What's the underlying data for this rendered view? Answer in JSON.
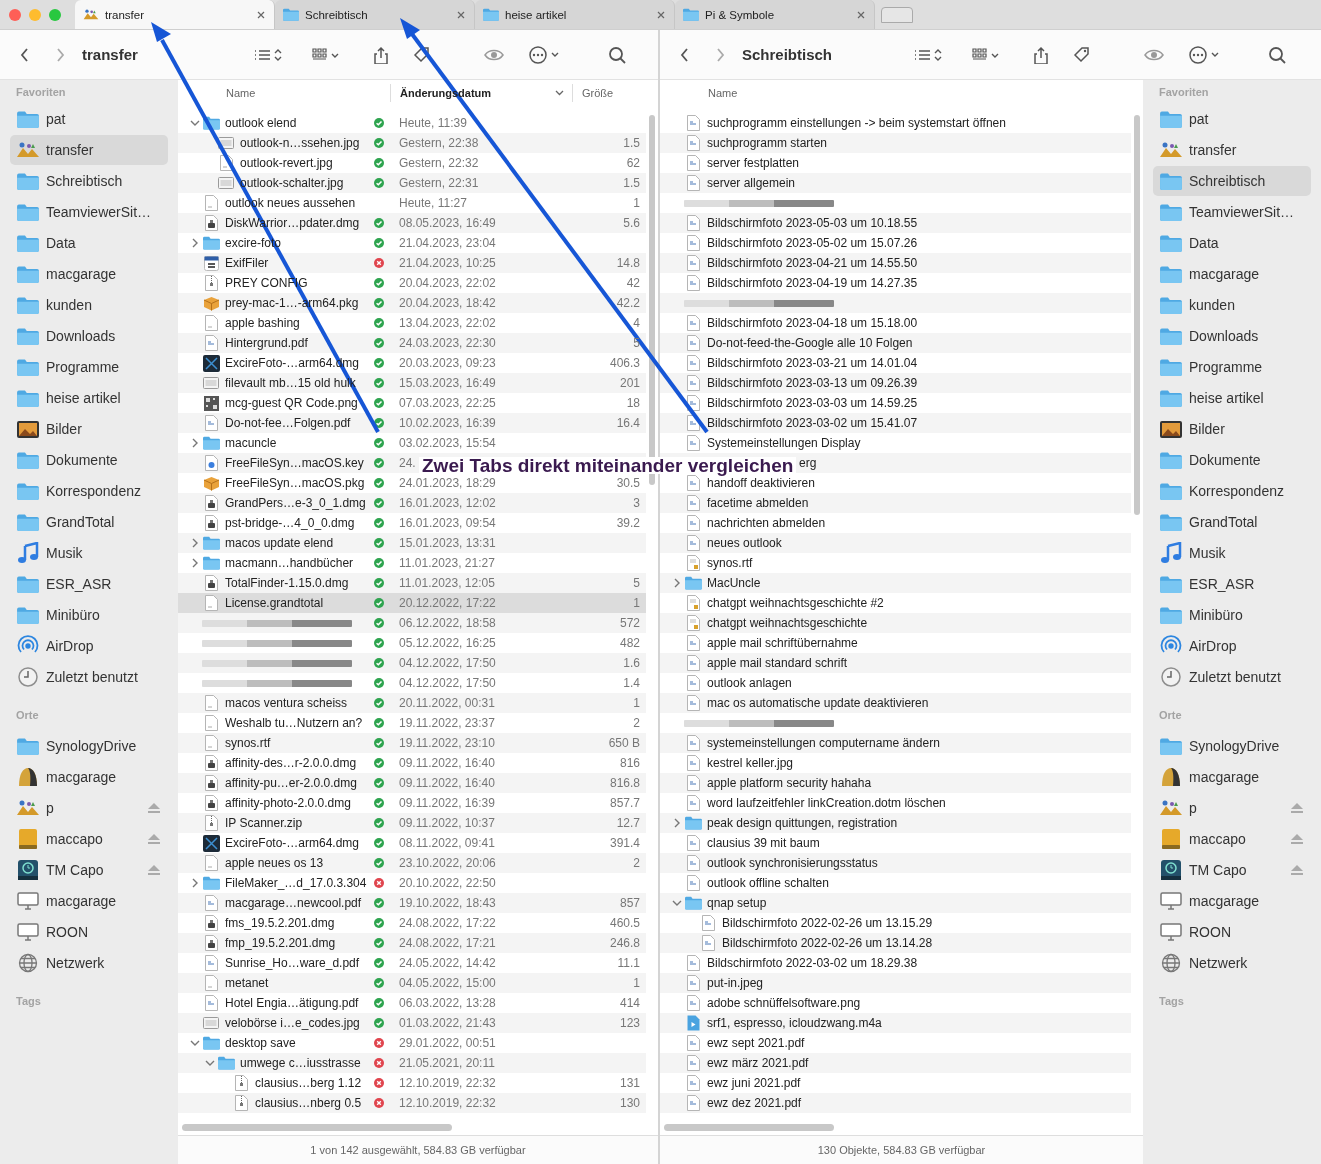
{
  "tabs": [
    {
      "label": "transfer",
      "kind": "image",
      "selected": true
    },
    {
      "label": "Schreibtisch",
      "kind": "folder",
      "selected": false
    },
    {
      "label": "heise artikel",
      "kind": "folder",
      "selected": false
    },
    {
      "label": "Pi & Symbole",
      "kind": "folder",
      "selected": false
    }
  ],
  "panes": [
    {
      "title": "transfer",
      "sidebar": [
        {
          "heading": "Favoriten",
          "items": [
            {
              "label": "pat",
              "kind": "folder",
              "selected": false
            },
            {
              "label": "transfer",
              "kind": "image",
              "selected": true
            },
            {
              "label": "Schreibtisch",
              "kind": "folder",
              "selected": false
            },
            {
              "label": "TeamviewerSit…",
              "kind": "folder",
              "selected": false
            },
            {
              "label": "Data",
              "kind": "folder",
              "selected": false
            },
            {
              "label": "macgarage",
              "kind": "folder",
              "selected": false
            },
            {
              "label": "kunden",
              "kind": "folder",
              "selected": false
            },
            {
              "label": "Downloads",
              "kind": "folder",
              "selected": false
            },
            {
              "label": "Programme",
              "kind": "folder",
              "selected": false
            },
            {
              "label": "heise artikel",
              "kind": "folder",
              "selected": false
            },
            {
              "label": "Bilder",
              "kind": "photo",
              "selected": false
            },
            {
              "label": "Dokumente",
              "kind": "folder",
              "selected": false
            },
            {
              "label": "Korrespondenz",
              "kind": "folder",
              "selected": false
            },
            {
              "label": "GrandTotal",
              "kind": "folder",
              "selected": false
            },
            {
              "label": "Musik",
              "kind": "music",
              "selected": false
            },
            {
              "label": "ESR_ASR",
              "kind": "folder",
              "selected": false
            },
            {
              "label": "Minibüro",
              "kind": "folder",
              "selected": false
            },
            {
              "label": "AirDrop",
              "kind": "airdrop",
              "selected": false
            },
            {
              "label": "Zuletzt benutzt",
              "kind": "clock",
              "selected": false
            }
          ]
        },
        {
          "heading": "Orte",
          "items": [
            {
              "label": "SynologyDrive",
              "kind": "folder",
              "selected": false,
              "eject": false
            },
            {
              "label": "macgarage",
              "kind": "dome",
              "selected": false,
              "eject": false
            },
            {
              "label": "p",
              "kind": "image",
              "selected": false,
              "eject": true
            },
            {
              "label": "maccapo",
              "kind": "drive",
              "selected": false,
              "eject": true
            },
            {
              "label": "TM Capo",
              "kind": "timemachine",
              "selected": false,
              "eject": true
            },
            {
              "label": "macgarage",
              "kind": "computer",
              "selected": false,
              "eject": false
            },
            {
              "label": "ROON",
              "kind": "computer",
              "selected": false,
              "eject": false
            },
            {
              "label": "Netzwerk",
              "kind": "network",
              "selected": false,
              "eject": false
            }
          ]
        },
        {
          "heading": "Tags"
        }
      ],
      "columns": [
        {
          "label": "Name",
          "sorted": false
        },
        {
          "label": "Änderungsdatum",
          "sorted": true
        },
        {
          "label": "Größe",
          "sorted": false
        }
      ],
      "rows": [
        {
          "name": "outlook elend",
          "kind": "folder",
          "expanded": true,
          "synced": true,
          "date": "Heute, 11:39",
          "selected": false,
          "children": [
            {
              "name": "outlook-n…ssehen.jpg",
              "kind": "image",
              "synced": true,
              "date": "Gestern, 22:38",
              "size": "1.5",
              "selected": false
            },
            {
              "name": "outlook-revert.jpg",
              "kind": "doc",
              "synced": true,
              "date": "Gestern, 22:32",
              "size": "62",
              "selected": false
            },
            {
              "name": "outlook-schalter.jpg",
              "kind": "image",
              "synced": true,
              "date": "Gestern, 22:31",
              "size": "1.5",
              "selected": false
            }
          ]
        },
        {
          "name": "outlook neues aussehen",
          "kind": "doc",
          "date": "Heute, 11:27",
          "size": "1",
          "selected": false
        },
        {
          "name": "DiskWarrior…pdater.dmg",
          "kind": "dmg",
          "synced": true,
          "date": "08.05.2023, 16:49",
          "size": "5.6",
          "selected": false
        },
        {
          "name": "excire-foto",
          "kind": "folder",
          "expanded": false,
          "synced": true,
          "date": "21.04.2023, 23:04",
          "selected": false
        },
        {
          "name": "ExifFiler",
          "kind": "calendar",
          "synced": false,
          "date": "21.04.2023, 10:25",
          "size": "14.8",
          "selected": false
        },
        {
          "name": "PREY CONFIG",
          "kind": "zip",
          "synced": true,
          "date": "20.04.2023, 22:02",
          "size": "42",
          "selected": false
        },
        {
          "name": "prey-mac-1…-arm64.pkg",
          "kind": "pkg",
          "synced": true,
          "date": "20.04.2023, 18:42",
          "size": "42.2",
          "selected": false
        },
        {
          "name": "apple bashing",
          "kind": "doc",
          "synced": true,
          "date": "13.04.2023, 22:02",
          "size": "4",
          "selected": false
        },
        {
          "name": "Hintergrund.pdf",
          "kind": "pdf",
          "synced": true,
          "date": "24.03.2023, 22:30",
          "size": "5",
          "selected": false
        },
        {
          "name": "ExcireFoto-…arm64.dmg",
          "kind": "app",
          "synced": true,
          "date": "20.03.2023, 09:23",
          "size": "406.3",
          "selected": false
        },
        {
          "name": "filevault mb…15 old hulk",
          "kind": "image",
          "synced": true,
          "date": "15.03.2023, 16:49",
          "size": "201",
          "selected": false
        },
        {
          "name": "mcg-guest QR Code.png",
          "kind": "qr",
          "synced": true,
          "date": "07.03.2023, 22:25",
          "size": "18",
          "selected": false
        },
        {
          "name": "Do-not-fee…Folgen.pdf",
          "kind": "pdf",
          "synced": true,
          "date": "10.02.2023, 16:39",
          "size": "16.4",
          "selected": false
        },
        {
          "name": "macuncle",
          "kind": "folder",
          "expanded": false,
          "synced": true,
          "date": "03.02.2023, 15:54",
          "selected": false
        },
        {
          "name": "FreeFileSyn…macOS.key",
          "kind": "key",
          "synced": true,
          "date": "24.",
          "selected": false
        },
        {
          "name": "FreeFileSyn…macOS.pkg",
          "kind": "pkg",
          "synced": true,
          "date": "24.01.2023, 18:29",
          "size": "30.5",
          "selected": false
        },
        {
          "name": "GrandPers…e-3_0_1.dmg",
          "kind": "dmg",
          "synced": true,
          "date": "16.01.2023, 12:02",
          "size": "3",
          "selected": false
        },
        {
          "name": "pst-bridge-…4_0_0.dmg",
          "kind": "dmg",
          "synced": true,
          "date": "16.01.2023, 09:54",
          "size": "39.2",
          "selected": false
        },
        {
          "name": "macos update elend",
          "kind": "folder",
          "expanded": false,
          "synced": true,
          "date": "15.01.2023, 13:31",
          "selected": false
        },
        {
          "name": "macmann…handbücher",
          "kind": "folder",
          "expanded": false,
          "synced": true,
          "date": "11.01.2023, 21:27",
          "selected": false
        },
        {
          "name": "TotalFinder-1.15.0.dmg",
          "kind": "dmg",
          "synced": true,
          "date": "11.01.2023, 12:05",
          "size": "5",
          "selected": false
        },
        {
          "name": "License.grandtotal",
          "kind": "doc",
          "synced": true,
          "date": "20.12.2022, 17:22",
          "size": "1",
          "selected": true
        },
        {
          "kind": "redacted",
          "synced": true,
          "date": "06.12.2022, 18:58",
          "size": "572",
          "selected": false
        },
        {
          "kind": "redacted",
          "synced": true,
          "date": "05.12.2022, 16:25",
          "size": "482",
          "selected": false
        },
        {
          "kind": "redacted",
          "synced": true,
          "date": "04.12.2022, 17:50",
          "size": "1.6",
          "selected": false
        },
        {
          "kind": "redacted",
          "synced": true,
          "date": "04.12.2022, 17:50",
          "size": "1.4",
          "selected": false
        },
        {
          "name": "macos ventura scheiss",
          "kind": "doc",
          "synced": true,
          "date": "20.11.2022, 00:31",
          "size": "1",
          "selected": false
        },
        {
          "name": "Weshalb tu…Nutzern an?",
          "kind": "doc",
          "synced": true,
          "date": "19.11.2022, 23:37",
          "size": "2",
          "selected": false
        },
        {
          "name": "synos.rtf",
          "kind": "doc",
          "synced": true,
          "date": "19.11.2022, 23:10",
          "size": "650 B",
          "selected": false
        },
        {
          "name": "affinity-des…r-2.0.0.dmg",
          "kind": "dmg",
          "synced": true,
          "date": "09.11.2022, 16:40",
          "size": "816",
          "selected": false
        },
        {
          "name": "affinity-pu…er-2.0.0.dmg",
          "kind": "dmg",
          "synced": true,
          "date": "09.11.2022, 16:40",
          "size": "816.8",
          "selected": false
        },
        {
          "name": "affinity-photo-2.0.0.dmg",
          "kind": "dmg",
          "synced": true,
          "date": "09.11.2022, 16:39",
          "size": "857.7",
          "selected": false
        },
        {
          "name": "IP Scanner.zip",
          "kind": "zip",
          "synced": true,
          "date": "09.11.2022, 10:37",
          "size": "12.7",
          "selected": false
        },
        {
          "name": "ExcireFoto-…arm64.dmg",
          "kind": "app",
          "synced": true,
          "date": "08.11.2022, 09:41",
          "size": "391.4",
          "selected": false
        },
        {
          "name": "apple neues os 13",
          "kind": "doc",
          "synced": true,
          "date": "23.10.2022, 20:06",
          "size": "2",
          "selected": false
        },
        {
          "name": "FileMaker_…d_17.0.3.304",
          "kind": "folder",
          "expanded": false,
          "synced": false,
          "date": "20.10.2022, 22:50",
          "selected": false
        },
        {
          "name": "macgarage…newcool.pdf",
          "kind": "pdf",
          "synced": true,
          "date": "19.10.2022, 18:43",
          "size": "857",
          "selected": false
        },
        {
          "name": "fms_19.5.2.201.dmg",
          "kind": "dmg",
          "synced": true,
          "date": "24.08.2022, 17:22",
          "size": "460.5",
          "selected": false
        },
        {
          "name": "fmp_19.5.2.201.dmg",
          "kind": "dmg",
          "synced": true,
          "date": "24.08.2022, 17:21",
          "size": "246.8",
          "selected": false
        },
        {
          "name": "Sunrise_Ho…ware_d.pdf",
          "kind": "pdf",
          "synced": true,
          "date": "24.05.2022, 14:42",
          "size": "11.1",
          "selected": false
        },
        {
          "name": "metanet",
          "kind": "doc",
          "synced": true,
          "date": "04.05.2022, 15:00",
          "size": "1",
          "selected": false
        },
        {
          "name": "Hotel Engia…ätigung.pdf",
          "kind": "pdf",
          "synced": true,
          "date": "06.03.2022, 13:28",
          "size": "414",
          "selected": false
        },
        {
          "name": "velobörse i…e_codes.jpg",
          "kind": "image",
          "synced": true,
          "date": "01.03.2022, 21:43",
          "size": "123",
          "selected": false
        },
        {
          "name": "desktop save",
          "kind": "folder",
          "expanded": true,
          "synced": false,
          "date": "29.01.2022, 00:51",
          "selected": false,
          "children": [
            {
              "name": "umwege c…iusstrasse",
              "kind": "folder",
              "expanded": true,
              "synced": false,
              "date": "21.05.2021, 20:11",
              "selected": false,
              "children": [
                {
                  "name": "clausius…berg 1.12",
                  "kind": "zip",
                  "synced": false,
                  "date": "12.10.2019, 22:32",
                  "size": "131",
                  "selected": false
                },
                {
                  "name": "clausius…nberg 0.5",
                  "kind": "zip",
                  "synced": false,
                  "date": "12.10.2019, 22:32",
                  "size": "130",
                  "selected": false
                }
              ]
            }
          ]
        }
      ],
      "status": "1 von 142 ausgewählt, 584.83 GB verfügbar"
    },
    {
      "title": "Schreibtisch",
      "sidebar": [
        {
          "heading": "Favoriten",
          "items": [
            {
              "label": "pat",
              "kind": "folder",
              "selected": false
            },
            {
              "label": "transfer",
              "kind": "image",
              "selected": false
            },
            {
              "label": "Schreibtisch",
              "kind": "folder",
              "selected": true
            },
            {
              "label": "TeamviewerSit…",
              "kind": "folder",
              "selected": false
            },
            {
              "label": "Data",
              "kind": "folder",
              "selected": false
            },
            {
              "label": "macgarage",
              "kind": "folder",
              "selected": false
            },
            {
              "label": "kunden",
              "kind": "folder",
              "selected": false
            },
            {
              "label": "Downloads",
              "kind": "folder",
              "selected": false
            },
            {
              "label": "Programme",
              "kind": "folder",
              "selected": false
            },
            {
              "label": "heise artikel",
              "kind": "folder",
              "selected": false
            },
            {
              "label": "Bilder",
              "kind": "photo",
              "selected": false
            },
            {
              "label": "Dokumente",
              "kind": "folder",
              "selected": false
            },
            {
              "label": "Korrespondenz",
              "kind": "folder",
              "selected": false
            },
            {
              "label": "GrandTotal",
              "kind": "folder",
              "selected": false
            },
            {
              "label": "Musik",
              "kind": "music",
              "selected": false
            },
            {
              "label": "ESR_ASR",
              "kind": "folder",
              "selected": false
            },
            {
              "label": "Minibüro",
              "kind": "folder",
              "selected": false
            },
            {
              "label": "AirDrop",
              "kind": "airdrop",
              "selected": false
            },
            {
              "label": "Zuletzt benutzt",
              "kind": "clock",
              "selected": false
            }
          ]
        },
        {
          "heading": "Orte",
          "items": [
            {
              "label": "SynologyDrive",
              "kind": "folder",
              "selected": false,
              "eject": false
            },
            {
              "label": "macgarage",
              "kind": "dome",
              "selected": false,
              "eject": false
            },
            {
              "label": "p",
              "kind": "image",
              "selected": false,
              "eject": true
            },
            {
              "label": "maccapo",
              "kind": "drive",
              "selected": false,
              "eject": true
            },
            {
              "label": "TM Capo",
              "kind": "timemachine",
              "selected": false,
              "eject": true
            },
            {
              "label": "macgarage",
              "kind": "computer",
              "selected": false,
              "eject": false
            },
            {
              "label": "ROON",
              "kind": "computer",
              "selected": false,
              "eject": false
            },
            {
              "label": "Netzwerk",
              "kind": "network",
              "selected": false,
              "eject": false
            }
          ]
        },
        {
          "heading": "Tags"
        }
      ],
      "columns": [
        {
          "label": "Name",
          "sorted": false
        }
      ],
      "rows": [
        {
          "name": "suchprogramm einstellungen -> beim systemstart öffnen",
          "kind": "pdf"
        },
        {
          "name": "suchprogramm starten",
          "kind": "pdf"
        },
        {
          "name": "server festplatten",
          "kind": "pdf"
        },
        {
          "name": "server allgemein",
          "kind": "pdf"
        },
        {
          "kind": "redacted"
        },
        {
          "name": "Bildschirmfoto 2023-05-03 um 10.18.55",
          "kind": "pdf"
        },
        {
          "name": "Bildschirmfoto 2023-05-02 um 15.07.26",
          "kind": "pdf"
        },
        {
          "name": "Bildschirmfoto 2023-04-21 um 14.55.50",
          "kind": "pdf"
        },
        {
          "name": "Bildschirmfoto 2023-04-19 um 14.27.35",
          "kind": "pdf"
        },
        {
          "kind": "redacted"
        },
        {
          "name": "Bildschirmfoto 2023-04-18 um 15.18.00",
          "kind": "pdf"
        },
        {
          "name": "Do-not-feed-the-Google alle 10 Folgen",
          "kind": "pdf"
        },
        {
          "name": "Bildschirmfoto 2023-03-21 um 14.01.04",
          "kind": "pdf"
        },
        {
          "name": "Bildschirmfoto 2023-03-13 um 09.26.39",
          "kind": "pdf"
        },
        {
          "name": "Bildschirmfoto 2023-03-03 um 14.59.25",
          "kind": "pdf"
        },
        {
          "name": "Bildschirmfoto 2023-03-02 um 15.41.07",
          "kind": "pdf"
        },
        {
          "name": "Systemeinstellungen Display",
          "kind": "pdf"
        },
        {
          "name": "erg",
          "kind": "covered"
        },
        {
          "name": "handoff deaktivieren",
          "kind": "pdf"
        },
        {
          "name": "facetime abmelden",
          "kind": "pdf"
        },
        {
          "name": "nachrichten abmelden",
          "kind": "pdf"
        },
        {
          "name": "neues outlook",
          "kind": "pdf"
        },
        {
          "name": "synos.rtf",
          "kind": "rtf"
        },
        {
          "name": "MacUncle",
          "kind": "folder",
          "expanded": false
        },
        {
          "name": "chatgpt weihnachtsgeschichte #2",
          "kind": "rtf"
        },
        {
          "name": "chatgpt weihnachtsgeschichte",
          "kind": "rtf"
        },
        {
          "name": "apple mail schriftübernahme",
          "kind": "pdf"
        },
        {
          "name": "apple mail standard schrift",
          "kind": "pdf"
        },
        {
          "name": "outlook anlagen",
          "kind": "pdf"
        },
        {
          "name": "mac os automatische update deaktivieren",
          "kind": "pdf"
        },
        {
          "kind": "redacted"
        },
        {
          "name": "systemeinstellungen computername ändern",
          "kind": "pdf"
        },
        {
          "name": "kestrel keller.jpg",
          "kind": "pdf"
        },
        {
          "name": "apple platform security hahaha",
          "kind": "pdf"
        },
        {
          "name": "word laufzeitfehler linkCreation.dotm löschen",
          "kind": "pdf"
        },
        {
          "name": "peak design quittungen, registration",
          "kind": "folder",
          "expanded": false
        },
        {
          "name": "clausius 39 mit baum",
          "kind": "pdf"
        },
        {
          "name": "outlook synchronisierungsstatus",
          "kind": "pdf"
        },
        {
          "name": "outlook offline schalten",
          "kind": "pdf"
        },
        {
          "name": "qnap setup",
          "kind": "folder",
          "expanded": true,
          "children": [
            {
              "name": "Bildschirmfoto 2022-02-26 um 13.15.29",
              "kind": "pdf"
            },
            {
              "name": "Bildschirmfoto 2022-02-26 um 13.14.28",
              "kind": "pdf"
            }
          ]
        },
        {
          "name": "Bildschirmfoto 2022-03-02 um 18.29.38",
          "kind": "pdf"
        },
        {
          "name": "put-in.jpeg",
          "kind": "pdf"
        },
        {
          "name": "adobe schnüffelsoftware.png",
          "kind": "pdf"
        },
        {
          "name": "srf1, espresso, icloudzwang.m4a",
          "kind": "audio"
        },
        {
          "name": "ewz sept 2021.pdf",
          "kind": "pdf"
        },
        {
          "name": "ewz märz 2021.pdf",
          "kind": "pdf"
        },
        {
          "name": "ewz juni 2021.pdf",
          "kind": "pdf"
        },
        {
          "name": "ewz dez 2021.pdf",
          "kind": "pdf"
        }
      ],
      "status": "130 Objekte, 584.83 GB verfügbar"
    }
  ],
  "annotation": {
    "caption": "Zwei Tabs direkt miteinander vergleichen"
  }
}
